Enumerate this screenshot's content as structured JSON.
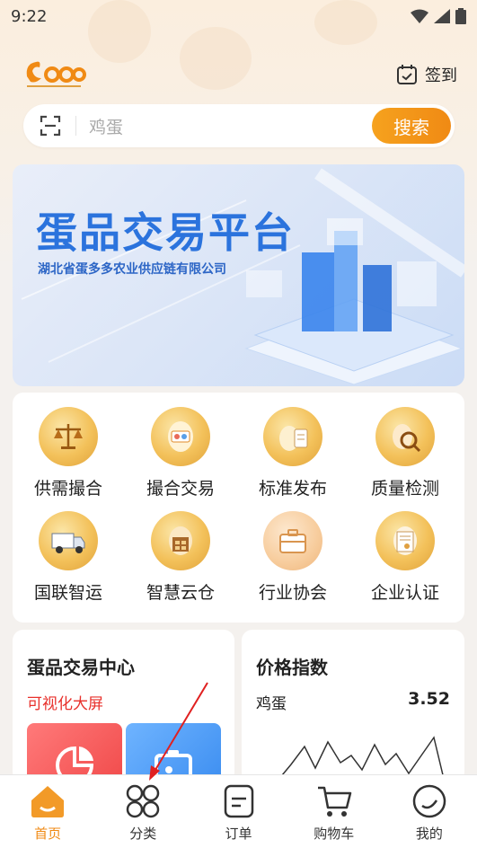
{
  "status": {
    "time": "9:22"
  },
  "header": {
    "checkin_label": "签到"
  },
  "search": {
    "placeholder": "鸡蛋",
    "button_label": "搜索"
  },
  "banner": {
    "title": "蛋品交易平台",
    "subtitle": "湖北省蛋多多农业供应链有限公司"
  },
  "grid": [
    {
      "label": "供需撮合",
      "icon": "scale-icon"
    },
    {
      "label": "撮合交易",
      "icon": "egg-card-icon"
    },
    {
      "label": "标准发布",
      "icon": "egg-document-icon"
    },
    {
      "label": "质量检测",
      "icon": "egg-magnifier-icon"
    },
    {
      "label": "国联智运",
      "icon": "truck-icon"
    },
    {
      "label": "智慧云仓",
      "icon": "warehouse-icon"
    },
    {
      "label": "行业协会",
      "icon": "briefcase-icon"
    },
    {
      "label": "企业认证",
      "icon": "certificate-icon"
    }
  ],
  "trade_center": {
    "title": "蛋品交易中心",
    "link": "可视化大屏"
  },
  "price_index": {
    "title": "价格指数",
    "item": "鸡蛋",
    "value": "3.52"
  },
  "tabs": [
    {
      "label": "首页",
      "icon": "home-icon",
      "active": true
    },
    {
      "label": "分类",
      "icon": "category-icon",
      "active": false
    },
    {
      "label": "订单",
      "icon": "order-icon",
      "active": false
    },
    {
      "label": "购物车",
      "icon": "cart-icon",
      "active": false
    },
    {
      "label": "我的",
      "icon": "profile-icon",
      "active": false
    }
  ],
  "colors": {
    "accent": "#f08a14",
    "banner_blue": "#2b73dd",
    "link_red": "#e8302b"
  }
}
